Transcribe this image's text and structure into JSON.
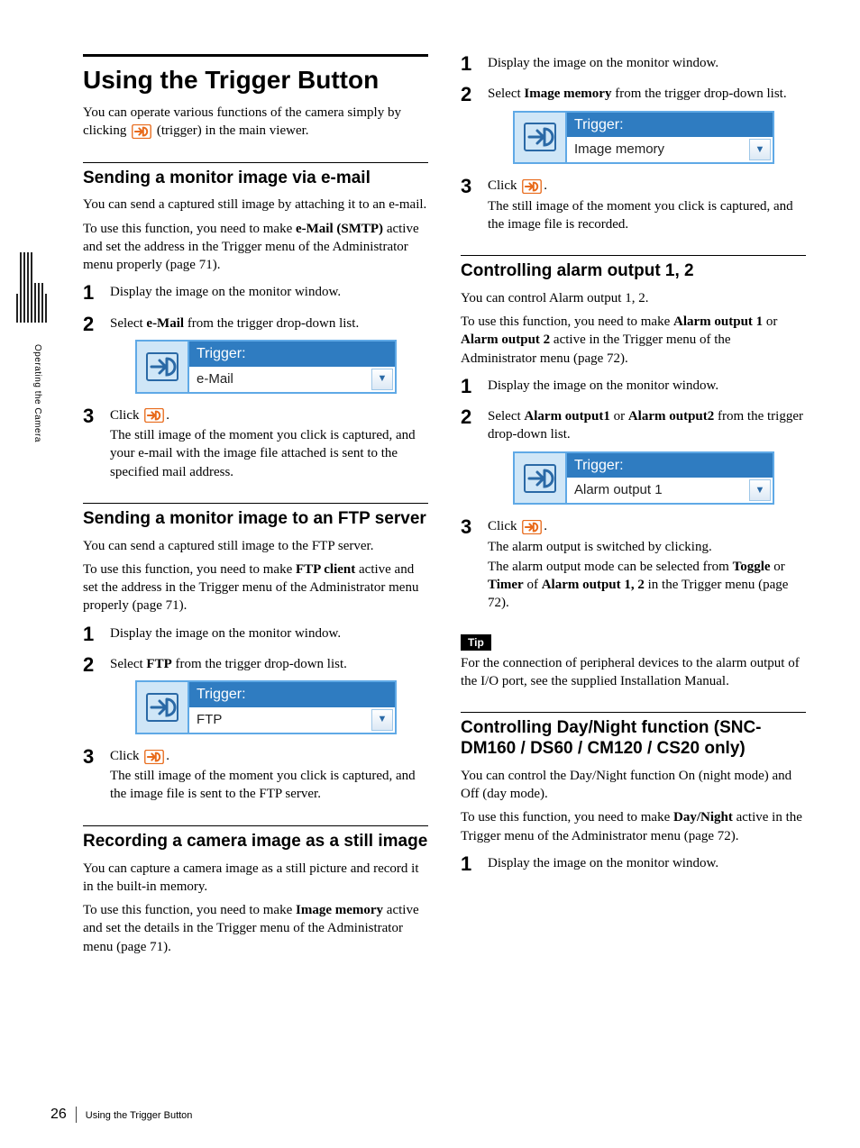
{
  "sideTab": "Operating the Camera",
  "footer": {
    "page": "26",
    "title": "Using the Trigger Button"
  },
  "left": {
    "h1": "Using the Trigger Button",
    "intro1a": "You can operate various functions of the camera simply by clicking ",
    "intro1b": " (trigger) in the main viewer.",
    "sec1": {
      "h": "Sending a monitor image via e-mail",
      "p1": "You can send a captured still image by attaching it to an e-mail.",
      "p2a": "To use this function, you need to make ",
      "p2b": "e-Mail (SMTP)",
      "p2c": " active and set the address in the Trigger menu of the Administrator menu properly (page 71).",
      "s1": "Display the image on the monitor window.",
      "s2a": "Select ",
      "s2b": "e-Mail",
      "s2c": " from the trigger drop-down list.",
      "dd": {
        "label": "Trigger:",
        "value": "e-Mail"
      },
      "s3a": "Click ",
      "s3b": ".",
      "s3c": "The still image of the moment you click is captured, and your e-mail with the image file attached is sent to the specified mail address."
    },
    "sec2": {
      "h": "Sending a monitor image to an FTP server",
      "p1": "You can send a captured still image to the FTP server.",
      "p2a": "To use this function, you need to make ",
      "p2b": "FTP client",
      "p2c": " active and set the address in the Trigger menu of the Administrator menu properly (page 71).",
      "s1": "Display the image on the monitor window.",
      "s2a": "Select ",
      "s2b": "FTP",
      "s2c": " from the trigger drop-down list.",
      "dd": {
        "label": "Trigger:",
        "value": "FTP"
      },
      "s3a": "Click ",
      "s3b": ".",
      "s3c": "The still image of the moment you click is captured, and the image file is sent to the FTP server."
    },
    "sec3": {
      "h": "Recording a camera image as a still image",
      "p1": "You can capture a camera image as a still picture and record it in the built-in memory.",
      "p2a": "To use this function, you need to make  ",
      "p2b": "Image memory",
      "p2c": " active and set the details in the Trigger menu of the Administrator menu (page 71)."
    }
  },
  "right": {
    "sec3cont": {
      "s1": "Display the image on the monitor window.",
      "s2a": "Select ",
      "s2b": "Image memory",
      "s2c": " from the trigger drop-down list.",
      "dd": {
        "label": "Trigger:",
        "value": "Image memory"
      },
      "s3a": "Click ",
      "s3b": ".",
      "s3c": "The still image of the moment you click is captured, and the image file is recorded."
    },
    "sec4": {
      "h": "Controlling alarm output 1, 2",
      "p1": "You can control Alarm output 1, 2.",
      "p2a": "To use this function, you need to make ",
      "p2b": "Alarm output 1",
      "p2c": " or ",
      "p2d": "Alarm output 2",
      "p2e": " active in the Trigger menu of the Administrator menu (page 72).",
      "s1": "Display the image on the monitor window.",
      "s2a": "Select ",
      "s2b": "Alarm output1",
      "s2c": " or ",
      "s2d": "Alarm output2",
      "s2e": " from the trigger drop-down list.",
      "dd": {
        "label": "Trigger:",
        "value": "Alarm output 1"
      },
      "s3a": "Click ",
      "s3b": ".",
      "s3c1": "The alarm output is switched by clicking.",
      "s3c2a": "The alarm output mode can be selected from ",
      "s3c2b": "Toggle",
      "s3c2c": " or ",
      "s3c2d": "Timer",
      "s3c2e": " of ",
      "s3c2f": "Alarm output 1, 2",
      "s3c2g": " in the Trigger menu (page 72).",
      "tipLabel": "Tip",
      "tip": "For the connection of peripheral devices to the alarm output of the I/O port, see the supplied Installation Manual."
    },
    "sec5": {
      "h": "Controlling Day/Night function (SNC-DM160 / DS60 / CM120 / CS20 only)",
      "p1": "You can control the Day/Night function On (night mode) and Off (day mode).",
      "p2a": "To use this function, you need to make ",
      "p2b": "Day/Night",
      "p2c": " active in the Trigger menu of the Administrator menu (page 72).",
      "s1": "Display the image on the monitor window."
    }
  }
}
